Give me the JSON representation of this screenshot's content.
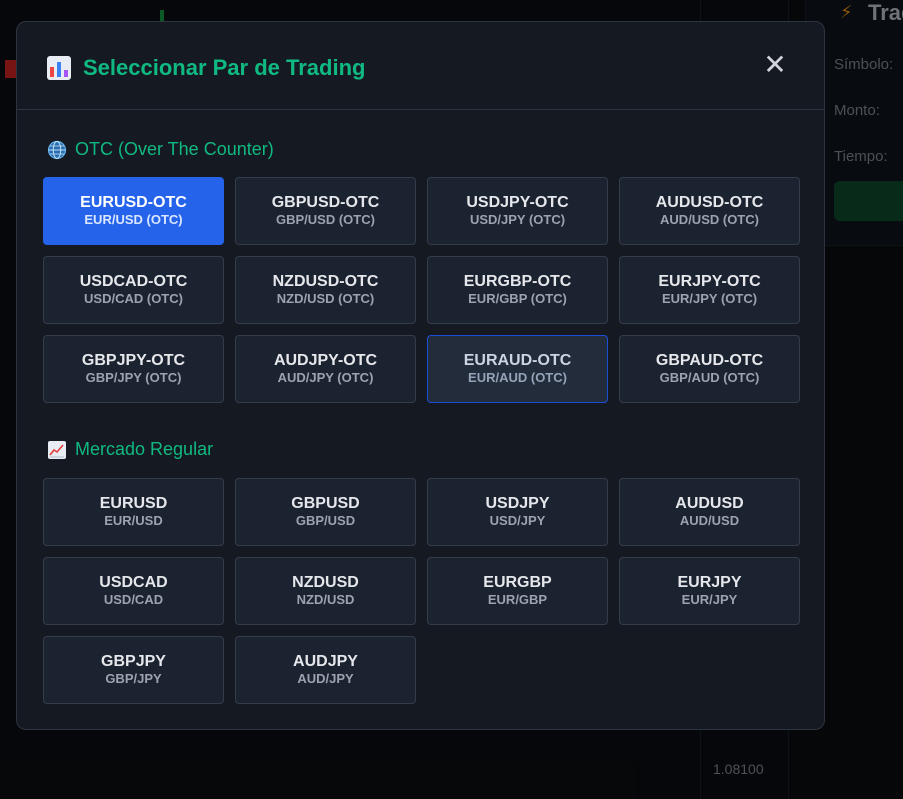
{
  "background": {
    "panel_title": "Trad",
    "labels": [
      "Símbolo:",
      "Monto:",
      "Tiempo:"
    ],
    "price": "1.08100"
  },
  "modal": {
    "title": "Seleccionar Par de Trading",
    "close_label": "✕"
  },
  "sections": {
    "otc": {
      "title": "OTC (Over The Counter)",
      "pairs": [
        {
          "symbol": "EURUSD-OTC",
          "label": "EUR/USD (OTC)",
          "state": "selected"
        },
        {
          "symbol": "GBPUSD-OTC",
          "label": "GBP/USD (OTC)",
          "state": ""
        },
        {
          "symbol": "USDJPY-OTC",
          "label": "USD/JPY (OTC)",
          "state": ""
        },
        {
          "symbol": "AUDUSD-OTC",
          "label": "AUD/USD (OTC)",
          "state": ""
        },
        {
          "symbol": "USDCAD-OTC",
          "label": "USD/CAD (OTC)",
          "state": ""
        },
        {
          "symbol": "NZDUSD-OTC",
          "label": "NZD/USD (OTC)",
          "state": ""
        },
        {
          "symbol": "EURGBP-OTC",
          "label": "EUR/GBP (OTC)",
          "state": ""
        },
        {
          "symbol": "EURJPY-OTC",
          "label": "EUR/JPY (OTC)",
          "state": ""
        },
        {
          "symbol": "GBPJPY-OTC",
          "label": "GBP/JPY (OTC)",
          "state": ""
        },
        {
          "symbol": "AUDJPY-OTC",
          "label": "AUD/JPY (OTC)",
          "state": ""
        },
        {
          "symbol": "EURAUD-OTC",
          "label": "EUR/AUD (OTC)",
          "state": "hover"
        },
        {
          "symbol": "GBPAUD-OTC",
          "label": "GBP/AUD (OTC)",
          "state": ""
        }
      ]
    },
    "regular": {
      "title": "Mercado Regular",
      "pairs": [
        {
          "symbol": "EURUSD",
          "label": "EUR/USD",
          "state": ""
        },
        {
          "symbol": "GBPUSD",
          "label": "GBP/USD",
          "state": ""
        },
        {
          "symbol": "USDJPY",
          "label": "USD/JPY",
          "state": ""
        },
        {
          "symbol": "AUDUSD",
          "label": "AUD/USD",
          "state": ""
        },
        {
          "symbol": "USDCAD",
          "label": "USD/CAD",
          "state": ""
        },
        {
          "symbol": "NZDUSD",
          "label": "NZD/USD",
          "state": ""
        },
        {
          "symbol": "EURGBP",
          "label": "EUR/GBP",
          "state": ""
        },
        {
          "symbol": "EURJPY",
          "label": "EUR/JPY",
          "state": ""
        },
        {
          "symbol": "GBPJPY",
          "label": "GBP/JPY",
          "state": ""
        },
        {
          "symbol": "AUDJPY",
          "label": "AUD/JPY",
          "state": ""
        }
      ]
    }
  },
  "colors": {
    "accent": "#10b981",
    "selected": "#2563eb"
  }
}
